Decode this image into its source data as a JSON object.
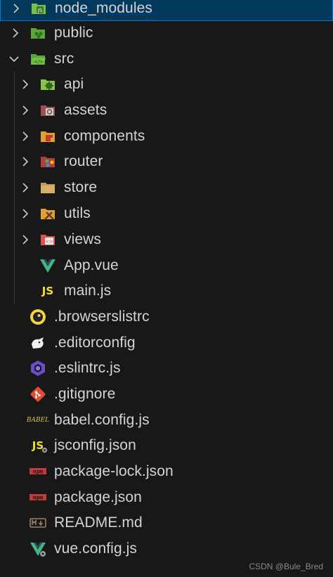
{
  "explorer": {
    "items": [
      {
        "label": "node_modules",
        "type": "folder",
        "expanded": false,
        "depth": 0,
        "icon": "node-modules-folder-icon",
        "color": "#7bc043"
      },
      {
        "label": "public",
        "type": "folder",
        "expanded": false,
        "depth": 0,
        "icon": "public-folder-icon",
        "color": "#5aa63a"
      },
      {
        "label": "src",
        "type": "folder",
        "expanded": true,
        "depth": 0,
        "icon": "src-folder-icon",
        "color": "#5aa63a"
      },
      {
        "label": "api",
        "type": "folder",
        "expanded": false,
        "depth": 1,
        "icon": "api-folder-icon",
        "color": "#8bc34a"
      },
      {
        "label": "assets",
        "type": "folder",
        "expanded": false,
        "depth": 1,
        "icon": "assets-folder-icon",
        "color": "#a05050"
      },
      {
        "label": "components",
        "type": "folder",
        "expanded": false,
        "depth": 1,
        "icon": "components-folder-icon",
        "color": "#e0a030"
      },
      {
        "label": "router",
        "type": "folder",
        "expanded": false,
        "depth": 1,
        "icon": "router-folder-icon",
        "color": "#b04040"
      },
      {
        "label": "store",
        "type": "folder",
        "expanded": false,
        "depth": 1,
        "icon": "store-folder-icon",
        "color": "#c49a5a"
      },
      {
        "label": "utils",
        "type": "folder",
        "expanded": false,
        "depth": 1,
        "icon": "utils-folder-icon",
        "color": "#e0a030"
      },
      {
        "label": "views",
        "type": "folder",
        "expanded": false,
        "depth": 1,
        "icon": "views-folder-icon",
        "color": "#d9534f"
      },
      {
        "label": "App.vue",
        "type": "file",
        "depth": 1,
        "icon": "vue-icon"
      },
      {
        "label": "main.js",
        "type": "file",
        "depth": 1,
        "icon": "javascript-icon"
      },
      {
        "label": ".browserslistrc",
        "type": "file",
        "depth": 0,
        "icon": "browserslist-icon"
      },
      {
        "label": ".editorconfig",
        "type": "file",
        "depth": 0,
        "icon": "editorconfig-icon"
      },
      {
        "label": ".eslintrc.js",
        "type": "file",
        "depth": 0,
        "icon": "eslint-icon"
      },
      {
        "label": ".gitignore",
        "type": "file",
        "depth": 0,
        "icon": "git-icon"
      },
      {
        "label": "babel.config.js",
        "type": "file",
        "depth": 0,
        "icon": "babel-icon"
      },
      {
        "label": "jsconfig.json",
        "type": "file",
        "depth": 0,
        "icon": "jsconfig-icon"
      },
      {
        "label": "package-lock.json",
        "type": "file",
        "depth": 0,
        "icon": "npm-icon"
      },
      {
        "label": "package.json",
        "type": "file",
        "depth": 0,
        "icon": "npm-icon"
      },
      {
        "label": "README.md",
        "type": "file",
        "depth": 0,
        "icon": "markdown-icon"
      },
      {
        "label": "vue.config.js",
        "type": "file",
        "depth": 0,
        "icon": "vue-config-icon"
      }
    ]
  },
  "icon_text": {
    "js": "JS",
    "babel": "BABEL",
    "npm": "npm",
    "md": "M↓",
    "code": "<>"
  },
  "watermark": "CSDN @Bule_Bred"
}
